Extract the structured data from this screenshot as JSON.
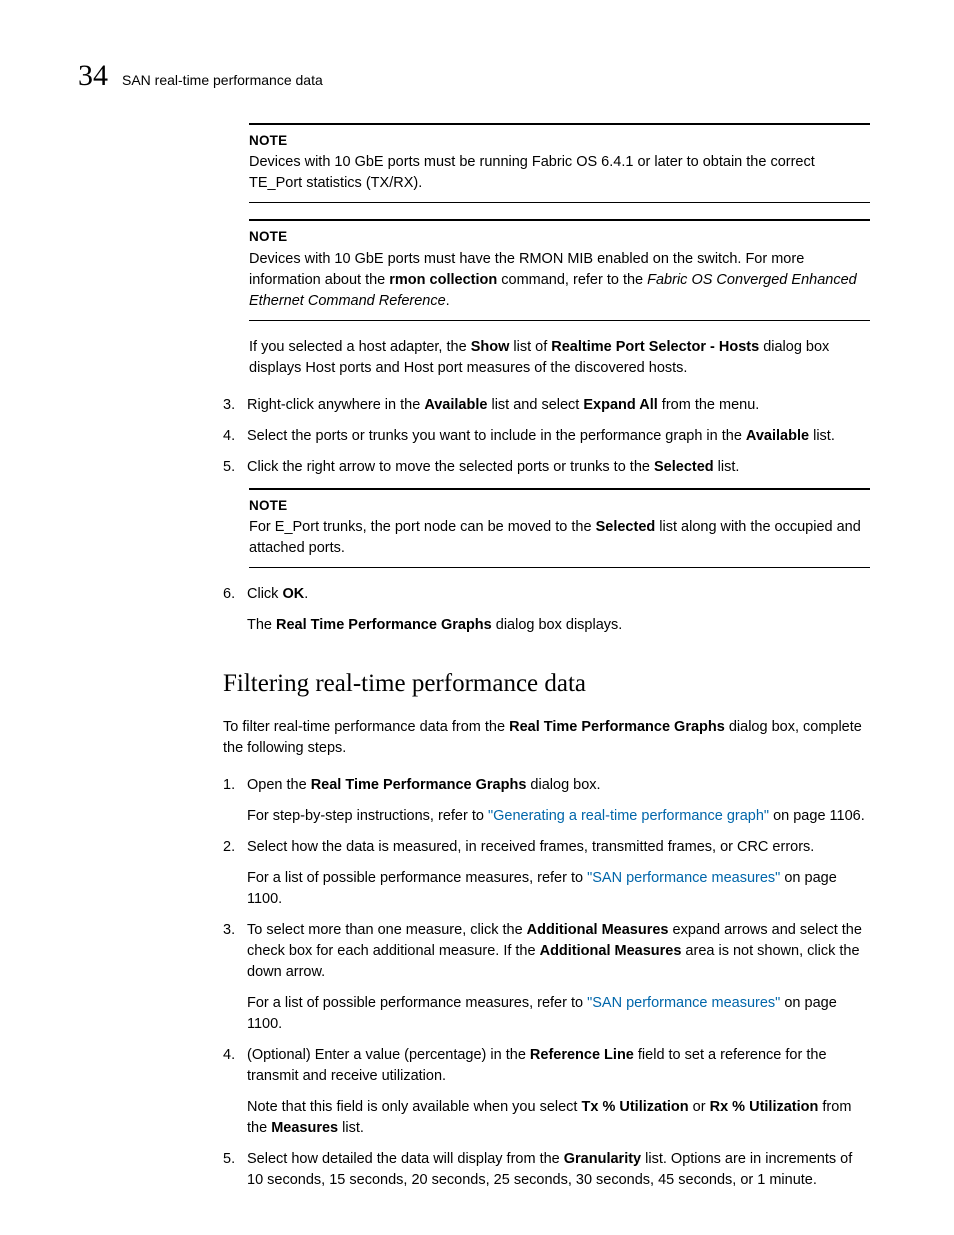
{
  "header": {
    "chapter_number": "34",
    "running_head": "SAN real-time performance data"
  },
  "note1": {
    "label": "NOTE",
    "text": "Devices with 10 GbE ports must be running Fabric OS 6.4.1 or later to obtain the correct TE_Port statistics (TX/RX)."
  },
  "note2": {
    "label": "NOTE",
    "pre": "Devices with 10 GbE ports must have the RMON MIB enabled on the switch. For more information about the ",
    "cmd": "rmon collection",
    "mid": " command, refer to the ",
    "doc": "Fabric OS Converged Enhanced Ethernet Command Reference",
    "post": "."
  },
  "para1": {
    "pre": "If you selected a host adapter, the ",
    "b1": "Show",
    "mid1": " list of ",
    "b2": "Realtime Port Selector - Hosts",
    "post": " dialog box displays Host ports and Host port measures of the discovered hosts."
  },
  "steps1": {
    "s3": {
      "num": "3.",
      "pre": "Right-click anywhere in the ",
      "b1": "Available",
      "mid": " list and select ",
      "b2": "Expand All",
      "post": " from the menu."
    },
    "s4": {
      "num": "4.",
      "pre": "Select the ports or trunks you want to include in the performance graph in the ",
      "b1": "Available",
      "post": " list."
    },
    "s5": {
      "num": "5.",
      "pre": "Click the right arrow to move the selected ports or trunks to the ",
      "b1": "Selected",
      "post": " list."
    }
  },
  "note3": {
    "label": "NOTE",
    "pre": "For E_Port trunks, the port node can be moved to the ",
    "b1": "Selected",
    "post": " list along with the occupied and attached ports."
  },
  "step6": {
    "num": "6.",
    "pre": "Click ",
    "b1": "OK",
    "post": ".",
    "sub_pre": "The ",
    "sub_b": "Real Time Performance Graphs",
    "sub_post": " dialog box displays."
  },
  "h2": "Filtering real-time performance data",
  "intro2": {
    "pre": "To filter real-time performance data from the ",
    "b1": "Real Time Performance Graphs",
    "post": " dialog box, complete the following steps."
  },
  "steps2": {
    "s1": {
      "num": "1.",
      "pre": "Open the ",
      "b1": "Real Time Performance Graphs",
      "post": " dialog box.",
      "sub_pre": "For step-by-step instructions, refer to ",
      "link": "\"Generating a real-time performance graph\"",
      "sub_post": " on page 1106."
    },
    "s2": {
      "num": "2.",
      "text": "Select how the data is measured, in received frames, transmitted frames, or CRC errors.",
      "sub_pre": "For a list of possible performance measures, refer to ",
      "link": "\"SAN performance measures\"",
      "sub_post": " on page 1100."
    },
    "s3": {
      "num": "3.",
      "pre": "To select more than one measure, click the ",
      "b1": "Additional Measures",
      "mid": " expand arrows and select the check box for each additional measure. If the ",
      "b2": "Additional Measures",
      "post": " area is not shown, click the down arrow.",
      "sub_pre": "For a list of possible performance measures, refer to ",
      "link": "\"SAN performance measures\"",
      "sub_post": " on page 1100."
    },
    "s4": {
      "num": "4.",
      "pre": "(Optional) Enter a value (percentage) in the ",
      "b1": "Reference Line",
      "post": " field to set a reference for the transmit and receive utilization.",
      "sub_pre": "Note that this field is only available when you select ",
      "sub_b1": "Tx % Utilization",
      "sub_mid": " or ",
      "sub_b2": "Rx % Utilization",
      "sub_mid2": " from the ",
      "sub_b3": "Measures",
      "sub_post": " list."
    },
    "s5": {
      "num": "5.",
      "pre": "Select how detailed the data will display from the ",
      "b1": "Granularity",
      "post": " list. Options are in increments of 10 seconds, 15 seconds, 20 seconds, 25 seconds, 30 seconds, 45 seconds, or 1 minute."
    }
  }
}
